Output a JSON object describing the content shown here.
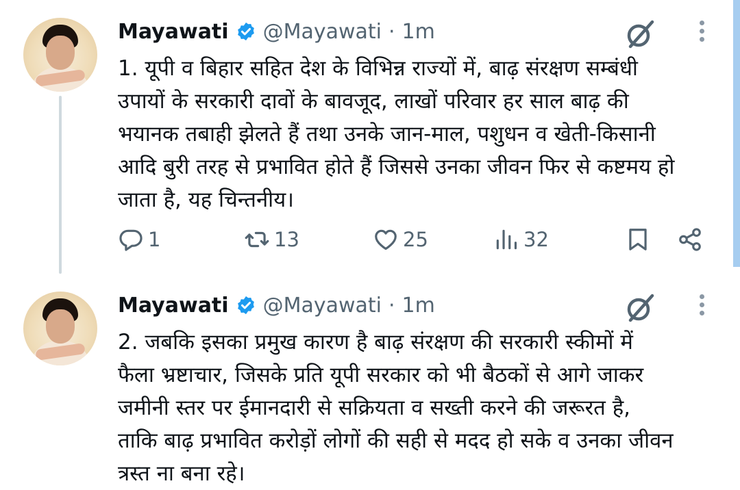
{
  "tweets": [
    {
      "author": {
        "name": "Mayawati",
        "handle": "@Mayawati",
        "separator": "·",
        "time": "1m"
      },
      "text": "1. यूपी व बिहार सहित देश के विभिन्न राज्यों में, बाढ़ संरक्षण सम्बंधी\nउपायों के सरकारी दावों के बावजूद, लाखों परिवार हर साल बाढ़ की\nभयानक तबाही झेलते हैं तथा उनके जान-माल, पशुधन व खेती-किसानी\nआदि बुरी तरह से प्रभावित होते हैं जिससे उनका जीवन फिर से कष्टमय हो\nजाता है, यह चिन्तनीय।",
      "metrics": {
        "replies": "1",
        "retweets": "13",
        "likes": "25",
        "views": "32"
      }
    },
    {
      "author": {
        "name": "Mayawati",
        "handle": "@Mayawati",
        "separator": "·",
        "time": "1m"
      },
      "text": "2. जबकि इसका प्रमुख कारण है बाढ़ संरक्षण की सरकारी स्कीमों में\nफैला भ्रष्टाचार, जिसके प्रति यूपी सरकार को भी बैठकों से आगे जाकर\nजमीनी स्तर पर ईमानदारी से सक्रियता व सख्ती करने की जरूरत है,\nताकि बाढ़ प्रभावित करोड़ों लोगों की सही से मदद हो सके व उनका जीवन\nत्रस्त ना बना रहे।"
    }
  ],
  "icons": {
    "verified": "verified-badge-icon",
    "grok": "grok-icon",
    "more": "more-vertical-icon",
    "reply": "reply-icon",
    "retweet": "retweet-icon",
    "like": "heart-icon",
    "views": "views-icon",
    "bookmark": "bookmark-icon",
    "share": "share-icon"
  },
  "colors": {
    "text": "#0f1419",
    "secondary": "#536471",
    "verified": "#1d9bf0",
    "thread_line": "#cfd9de"
  }
}
